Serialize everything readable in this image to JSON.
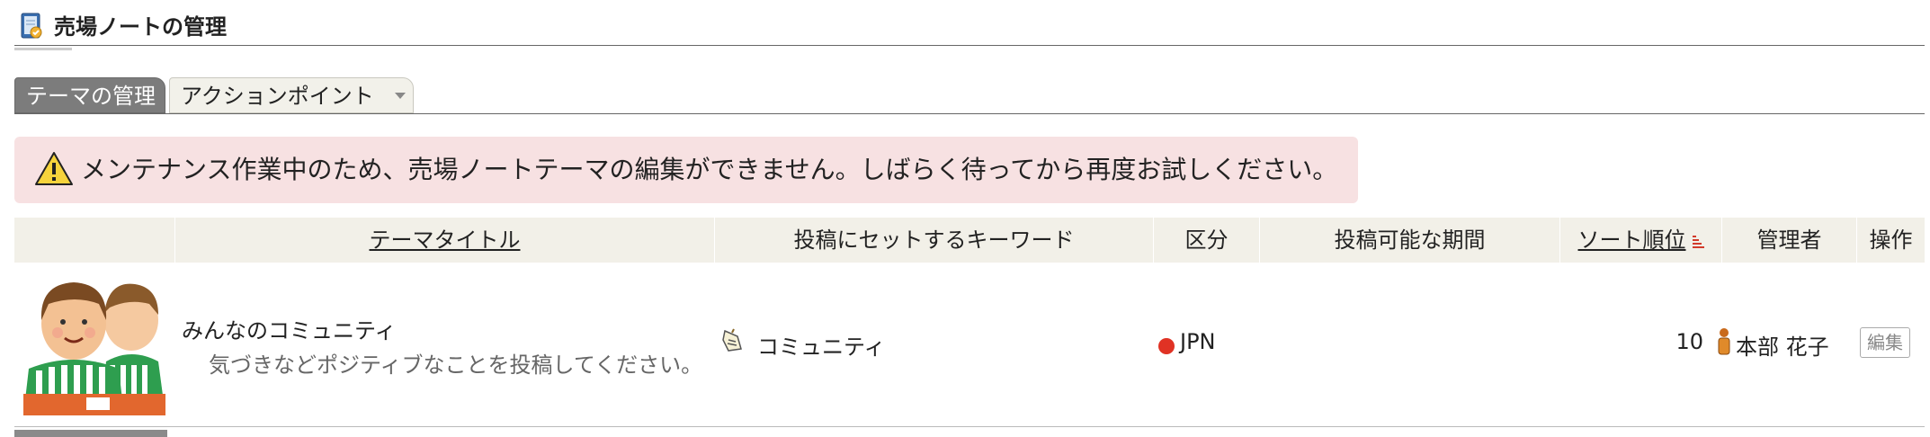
{
  "header": {
    "title": "売場ノートの管理",
    "icon": "notebook-icon"
  },
  "tabs": [
    {
      "label": "テーマの管理",
      "active": true
    },
    {
      "label": "アクションポイント",
      "active": false,
      "has_dropdown": true
    }
  ],
  "alert": {
    "icon": "warning-icon",
    "message": "メンテナンス作業中のため、売場ノートテーマの編集ができません。しばらく待ってから再度お試しください。",
    "background": "#f7e1e2"
  },
  "table": {
    "columns": [
      {
        "key": "image",
        "label": ""
      },
      {
        "key": "title",
        "label": "テーマタイトル",
        "sortable_link": true
      },
      {
        "key": "keyword",
        "label": "投稿にセットするキーワード"
      },
      {
        "key": "category",
        "label": "区分"
      },
      {
        "key": "period",
        "label": "投稿可能な期間"
      },
      {
        "key": "sort",
        "label": "ソート順位",
        "sortable_link": true,
        "sorted": "asc"
      },
      {
        "key": "manager",
        "label": "管理者"
      },
      {
        "key": "actions",
        "label": "操作"
      }
    ],
    "rows": [
      {
        "image": "store-staff-illustration",
        "title": "みんなのコミュニティ",
        "description": "気づきなどポジティブなことを投稿してください。",
        "keyword": "コミュニティ",
        "keyword_icon": "hand-tag-icon",
        "category": "JPN",
        "category_color": "#e03224",
        "period": "",
        "sort": "10",
        "manager": "本部 花子",
        "manager_icon": "person-icon",
        "action_label": "編集"
      }
    ]
  },
  "colors": {
    "header_bg": "#f2f0e8",
    "active_tab": "#7c7c7c"
  }
}
